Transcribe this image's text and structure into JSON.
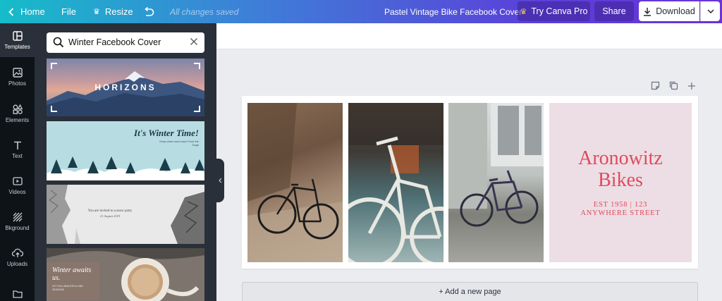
{
  "topbar": {
    "home": "Home",
    "file": "File",
    "resize": "Resize",
    "saved_status": "All changes saved",
    "design_title": "Pastel Vintage Bike Facebook Cover",
    "try_pro": "Try Canva Pro",
    "share": "Share",
    "download": "Download"
  },
  "sidebar": {
    "items": [
      {
        "label": "Templates",
        "icon": "templates-icon"
      },
      {
        "label": "Photos",
        "icon": "photos-icon"
      },
      {
        "label": "Elements",
        "icon": "elements-icon"
      },
      {
        "label": "Text",
        "icon": "text-icon"
      },
      {
        "label": "Videos",
        "icon": "videos-icon"
      },
      {
        "label": "Bkground",
        "icon": "background-icon"
      },
      {
        "label": "Uploads",
        "icon": "uploads-icon"
      },
      {
        "label": "",
        "icon": "folder-icon"
      }
    ]
  },
  "search": {
    "value": "Winter Facebook Cover"
  },
  "templates": [
    {
      "title": "HORIZONS"
    },
    {
      "title": "It's Winter Time!",
      "subtitle": "Keep warm and cozy! From the Dogs"
    },
    {
      "line1": "You are invited to a snow party",
      "line2": "21 August 2019"
    },
    {
      "title": "Winter awaits us.",
      "subtitle": "LET FALL BEAUTIFUL AND SEASONS"
    }
  ],
  "design": {
    "title": "Aronowitz Bikes",
    "subtitle_line1": "EST 1958 | 123",
    "subtitle_line2": "ANYWHERE STREET",
    "accent_color": "#e0495f",
    "card_color": "#ecdee4"
  },
  "add_page": "+ Add a new page",
  "colors": {
    "topbar_gradient_start": "#16bcc9",
    "topbar_gradient_end": "#6a34d6",
    "rail": "#0e1318",
    "panel": "#293039"
  }
}
